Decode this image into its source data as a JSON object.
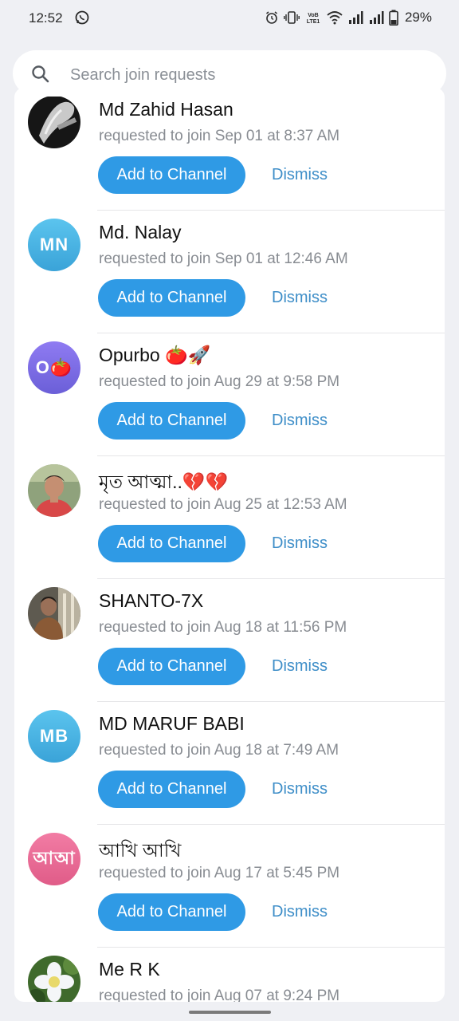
{
  "status_bar": {
    "time": "12:52",
    "battery": "29%"
  },
  "search": {
    "placeholder": "Search join requests"
  },
  "requests": [
    {
      "name": "Md Zahid Hasan",
      "subtitle": "requested to join Sep 01 at 8:37 AM",
      "avatar": {
        "type": "photo",
        "icon": "photo-hand"
      }
    },
    {
      "name": "Md. Nalay",
      "subtitle": "requested to join Sep 01 at 12:46 AM",
      "avatar": {
        "type": "initials",
        "initials": "MN",
        "color_top": "#5bc4ee",
        "color_bottom": "#3aa3d8"
      }
    },
    {
      "name": "Opurbo 🍅🚀",
      "subtitle": "requested to join Aug 29 at 9:58 PM",
      "avatar": {
        "type": "initials",
        "initials": "O🍅",
        "color_top": "#8f7bf2",
        "color_bottom": "#6b5fd8"
      }
    },
    {
      "name": "মৃত আত্মা..💔💔",
      "subtitle": "requested to join Aug 25 at 12:53 AM",
      "avatar": {
        "type": "photo",
        "icon": "photo-person-red"
      }
    },
    {
      "name": "SHANTO-7X",
      "subtitle": "requested to join Aug 18 at 11:56 PM",
      "avatar": {
        "type": "photo",
        "icon": "photo-person-hall"
      }
    },
    {
      "name": "MD MARUF BABI",
      "subtitle": "requested to join Aug 18 at 7:49 AM",
      "avatar": {
        "type": "initials",
        "initials": "MB",
        "color_top": "#5bc4ee",
        "color_bottom": "#3aa3d8"
      }
    },
    {
      "name": "আখি আখি",
      "subtitle": "requested to join Aug 17 at 5:45 PM",
      "avatar": {
        "type": "initials",
        "initials": "আআ",
        "color_top": "#f27ca4",
        "color_bottom": "#e05c88"
      }
    },
    {
      "name": "Me R K",
      "subtitle": "requested to join Aug 07 at 9:24 PM",
      "avatar": {
        "type": "photo",
        "icon": "photo-flower"
      }
    }
  ],
  "actions": {
    "add_label": "Add to Channel",
    "dismiss_label": "Dismiss"
  },
  "colors": {
    "accent": "#2f9ae5",
    "dismiss": "#3e8ec8",
    "background": "#eff0f4"
  }
}
